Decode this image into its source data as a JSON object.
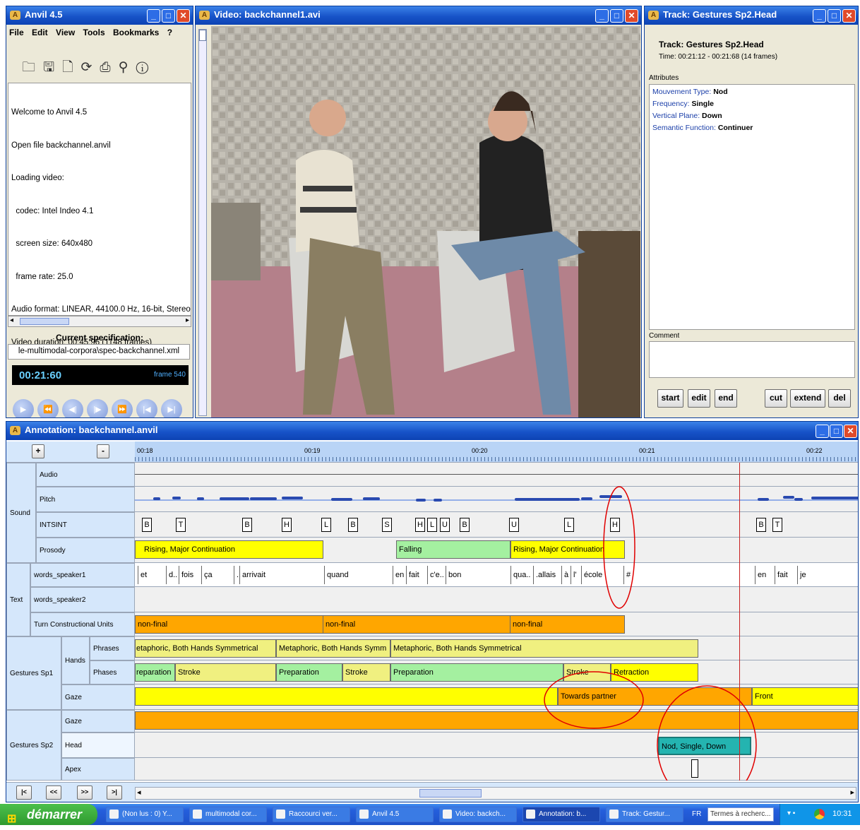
{
  "anvil": {
    "title": "Anvil 4.5",
    "menu": [
      "File",
      "Edit",
      "View",
      "Tools",
      "Bookmarks",
      "?"
    ],
    "log": [
      "Welcome to Anvil 4.5",
      "Open file backchannel.anvil",
      "Loading video:",
      "  codec: Intel Indeo 4.1",
      "  screen size: 640x480",
      "  frame rate: 25.0",
      "Audio format: LINEAR, 44100.0 Hz, 16-bit, Stereo",
      "Video duration: 00:45:96 (1148 frames)"
    ],
    "spec_heading": "Current specification:",
    "spec_path": "le-multimodal-corpora\\spec-backchannel.xml",
    "time": "00:21:60",
    "frame": "frame 540"
  },
  "video": {
    "title": "Video: backchannel1.avi"
  },
  "track": {
    "title": "Track: Gestures Sp2.Head",
    "heading": "Track: Gestures Sp2.Head",
    "time": "Time: 00:21:12 - 00:21:68 (14 frames)",
    "attributes_label": "Attributes",
    "attributes": [
      {
        "k": "Mouvement Type:",
        "v": "Nod"
      },
      {
        "k": "Frequency:",
        "v": "Single"
      },
      {
        "k": "Vertical Plane:",
        "v": "Down"
      },
      {
        "k": "Semantic Function:",
        "v": "Continuer"
      }
    ],
    "comment_label": "Comment",
    "buttons": [
      "start",
      "edit",
      "end",
      "cut",
      "extend",
      "del"
    ]
  },
  "annotation": {
    "title": "Annotation: backchannel.anvil",
    "plus": "+",
    "minus": "-",
    "ticks": [
      "00:18",
      "00:19",
      "00:20",
      "00:21",
      "00:22"
    ],
    "groups": {
      "sound": "Sound",
      "text": "Text",
      "sp1": "Gestures Sp1",
      "hands": "Hands",
      "sp2": "Gestures Sp2"
    },
    "tracks": {
      "audio": "Audio",
      "pitch": "Pitch",
      "intsint": "INTSINT",
      "prosody": "Prosody",
      "ws1": "words_speaker1",
      "ws2": "words_speaker2",
      "tcu": "Turn Constructional Units",
      "phrases": "Phrases",
      "phases": "Phases",
      "gaze1": "Gaze",
      "gaze2": "Gaze",
      "head": "Head",
      "apex": "Apex"
    },
    "intsint": [
      "B",
      "T",
      "B",
      "H",
      "L",
      "B",
      "S",
      "H",
      "L",
      "U",
      "B",
      "U",
      "L",
      "H",
      "B",
      "T"
    ],
    "prosody": [
      "Rising, Major Continuation",
      "Falling",
      "Rising, Major Continuation"
    ],
    "words": [
      "et",
      "d..",
      "fois",
      "ça",
      "..",
      "arrivait",
      "quand",
      "en",
      "fait",
      "c'e..",
      "bon",
      "qua..",
      ".allais",
      "à",
      "l'",
      "école",
      "#",
      "en",
      "fait",
      "je"
    ],
    "tcu": [
      "non-final",
      "non-final",
      "non-final"
    ],
    "phrases": [
      "etaphoric, Both Hands Symmetrical",
      "Metaphoric, Both Hands Symm",
      "Metaphoric, Both Hands Symmetrical"
    ],
    "phases": [
      "reparation",
      "Stroke",
      "Preparation",
      "Stroke",
      "Preparation",
      "Stroke",
      "Retraction"
    ],
    "gaze1": [
      "Towards partner",
      "Front"
    ],
    "head": "Nod, Single, Down",
    "nav": [
      "|<",
      "<<",
      ">>",
      ">|"
    ]
  },
  "taskbar": {
    "start": "démarrer",
    "items": [
      "(Non lus : 0) Y...",
      "multimodal cor...",
      "Raccourci ver...",
      "Anvil 4.5",
      "Video: backch...",
      "Annotation: b...",
      "Track: Gestur..."
    ],
    "lang": "FR",
    "search": "Termes à recherc...",
    "clock": "10:31"
  },
  "colors": {
    "title_bar": "#1753c8",
    "prosody_rising": "#ffff00",
    "prosody_falling": "#a4f0a0",
    "tcu": "#ffa600",
    "head": "#24b4b0",
    "highlight": "#e00000"
  }
}
